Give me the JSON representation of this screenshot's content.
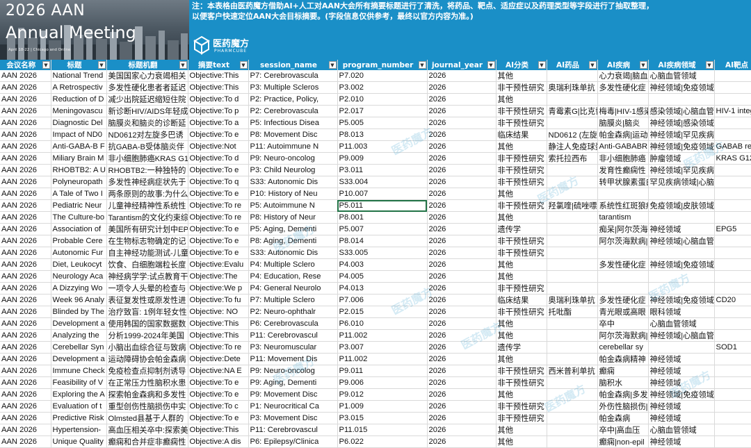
{
  "banner": {
    "hero_title_line1": "2026 AAN",
    "hero_title_line2": "Annual Meeting",
    "hero_sub": "April 18-22 | Chicago and Online",
    "note_line1": "注：本表格由医药魔方借助AI+人工对AAN大会所有摘要标题进行了清洗，将药品、靶点、适应症以及药理类型等字段进行了抽取整理，",
    "note_line2": "以便客户快速定位AAN大会目标摘要。(字段信息仅供参考，最终以官方内容为准。)",
    "logo_name": "医药魔方",
    "logo_sub": "PHARMCUBE",
    "brand_color": "#1a8fc7"
  },
  "table": {
    "columns": [
      "会议名称",
      "标题",
      "标题机翻",
      "摘要text",
      "session_name",
      "program_number",
      "journal_year",
      "AI分类",
      "AI药品",
      "AI疾病",
      "AI疾病领域",
      "AI靶点"
    ],
    "rows": [
      [
        "AAN 2026",
        "National Trend",
        "美国国家心力衰竭相关",
        "Objective:This",
        "P7: Cerebrovascula",
        "P7.020",
        "2026",
        "其他",
        "",
        "心力衰竭|脑血",
        "心脑血管领域",
        ""
      ],
      [
        "AAN 2026",
        "A Retrospectiv",
        "多发性硬化患者者延迟",
        "Objective:This",
        "P3: Multiple Scleros",
        "P3.002",
        "2026",
        "非干预性研究",
        "奥瑞利珠单抗",
        "多发性硬化症",
        "神经领域|免疫领域",
        ""
      ],
      [
        "AAN 2026",
        "Reduction of D",
        "减少出院延迟缩短住院",
        "Objective:To d",
        "P2: Practice, Policy,",
        "P2.010",
        "2026",
        "其他",
        "",
        "",
        "",
        ""
      ],
      [
        "AAN 2026",
        "Meningovascu",
        "新诊断HIV/AIDS年轻成",
        "Objective:To p",
        "P2: Cerebrovascula",
        "P2.017",
        "2026",
        "非干预性研究",
        "青霉素G|比克替",
        "梅毒|HIV-1感染",
        "感染领域|心脑血管",
        "HIV-1 integrase"
      ],
      [
        "AAN 2026",
        "Diagnostic Del",
        "脑膜炎和脑炎的诊断延",
        "Objective:To a",
        "P5: Infectious Disea",
        "P5.005",
        "2026",
        "非干预性研究",
        "",
        "脑膜炎|脑炎",
        "神经领域|感染领域",
        ""
      ],
      [
        "AAN 2026",
        "Impact of ND0",
        "ND0612对左旋多巴诱",
        "Objective:To e",
        "P8: Movement Disc",
        "P8.013",
        "2026",
        "临床结果",
        "ND0612 (左旋",
        "帕金森病|运动",
        "神经领域|罕见疾病",
        ""
      ],
      [
        "AAN 2026",
        "Anti-GABA-B F",
        "抗GABA-B受体脑炎伴",
        "Objective:Not",
        "P11: Autoimmune N",
        "P11.003",
        "2026",
        "其他",
        "静注人免疫球蛋",
        "Anti-GABABR",
        "神经领域|免疫领域",
        "GABAB receptor"
      ],
      [
        "AAN 2026",
        "Miliary Brain M",
        "非小细胞肺癌KRAS G1",
        "Objective:To d",
        "P9: Neuro-oncolog",
        "P9.009",
        "2026",
        "非干预性研究",
        "索托拉西布",
        "非小细胞肺癌",
        "肿瘤领域",
        "KRAS G12C"
      ],
      [
        "AAN 2026",
        "RHOBTB2: A U",
        "RHOBTB2:一种独特的",
        "Objective:To e",
        "P3: Child Neurolog",
        "P3.011",
        "2026",
        "非干预性研究",
        "",
        "发育性癫痫性",
        "神经领域|罕见疾病",
        ""
      ],
      [
        "AAN 2026",
        "Polyneuropath",
        "多发性神经病症状先于",
        "Objective:To q",
        "S33: Autonomic Dis",
        "S33.004",
        "2026",
        "非干预性研究",
        "",
        "转甲状腺素蛋白",
        "罕见疾病领域|心脑",
        ""
      ],
      [
        "AAN 2026",
        "A Tale of Two I",
        "两条原则的故事:为什么",
        "Objective:To e",
        "P10: History of Neu",
        "P10.007",
        "2026",
        "其他",
        "",
        "",
        "",
        ""
      ],
      [
        "AAN 2026",
        "Pediatric Neur",
        "儿童神经精神性系统性",
        "Objective:To re",
        "P5: Autoimmune N",
        "P5.011",
        "2026",
        "非干预性研究",
        "羟氯喹|硫唑嘌",
        "系统性红斑狼疮",
        "免疫领域|皮肤领域",
        ""
      ],
      [
        "AAN 2026",
        "The Culture-bo",
        "Tarantism的文化约束综",
        "Objective:To re",
        "P8: History of Neur",
        "P8.001",
        "2026",
        "其他",
        "",
        "tarantism",
        "",
        ""
      ],
      [
        "AAN 2026",
        "Association of",
        "美国所有研究计划中EP",
        "Objective:To e",
        "P5: Aging, Dementi",
        "P5.007",
        "2026",
        "遗传学",
        "",
        "痴呆|阿尔茨海",
        "神经领域",
        "EPG5"
      ],
      [
        "AAN 2026",
        "Probable Cere",
        "在生物标志物确定的记",
        "Objective:To e",
        "P8: Aging, Dementi",
        "P8.014",
        "2026",
        "非干预性研究",
        "",
        "阿尔茨海默病|",
        "神经领域|心脑血管",
        ""
      ],
      [
        "AAN 2026",
        "Autonomic Fur",
        "自主神经功能测试-儿童",
        "Objective:To e",
        "S33: Autonomic Dis",
        "S33.005",
        "2026",
        "非干预性研究",
        "",
        "",
        "",
        ""
      ],
      [
        "AAN 2026",
        "Diet, Leukocyt",
        "饮食、白细胞端粒长度",
        "Objective:Evalu",
        "P4: Multiple Sclero",
        "P4.003",
        "2026",
        "其他",
        "",
        "多发性硬化症",
        "神经领域|免疫领域",
        ""
      ],
      [
        "AAN 2026",
        "Neurology Aca",
        "神经病学学:试点教育干",
        "Objective:The",
        "P4: Education, Rese",
        "P4.005",
        "2026",
        "其他",
        "",
        "",
        "",
        ""
      ],
      [
        "AAN 2026",
        "A Dizzying Wo",
        "一项令人头晕的检查与",
        "Objective:We p",
        "P4: General Neurolo",
        "P4.013",
        "2026",
        "非干预性研究",
        "",
        "",
        "",
        ""
      ],
      [
        "AAN 2026",
        "Week 96 Analy",
        "表征复发性或原发性进",
        "Objective:To fu",
        "P7: Multiple Sclero",
        "P7.006",
        "2026",
        "临床结果",
        "奥瑞利珠单抗",
        "多发性硬化症",
        "神经领域|免疫领域",
        "CD20"
      ],
      [
        "AAN 2026",
        "Blinded by The",
        "治疗致盲: 1例年轻女性",
        "Objective: NO",
        "P2: Neuro-ophthalr",
        "P2.015",
        "2026",
        "非干预性研究",
        "托吡酯",
        "青光眼或高眼",
        "眼科领域",
        ""
      ],
      [
        "AAN 2026",
        "Development a",
        "使用韩国的国家数据数",
        "Objective:This",
        "P6: Cerebrovascula",
        "P6.010",
        "2026",
        "其他",
        "",
        "卒中",
        "心脑血管领域",
        ""
      ],
      [
        "AAN 2026",
        "Analyzing the",
        "分析1999-2024年美国",
        "Objective:This",
        "P11: Cerebrovascul",
        "P11.002",
        "2026",
        "其他",
        "",
        "阿尔茨海默病|",
        "神经领域|心脑血管",
        ""
      ],
      [
        "AAN 2026",
        "Cerebellar Syn",
        "小脑出血综合征与致病",
        "Objective:To re",
        "P3: Neuromuscular",
        "P3.007",
        "2026",
        "遗传学",
        "",
        "cerebellar sy",
        "",
        "SOD1"
      ],
      [
        "AAN 2026",
        "Development a",
        "运动障碍协会帕金森病",
        "Objective:Dete",
        "P11: Movement Dis",
        "P11.002",
        "2026",
        "其他",
        "",
        "帕金森病精神",
        "神经领域",
        ""
      ],
      [
        "AAN 2026",
        "Immune Check",
        "免疫检查点抑制剂诱导",
        "Objective:NA E",
        "P9: Neuro-oncolog",
        "P9.011",
        "2026",
        "非干预性研究",
        "西米普利单抗",
        "癫痫",
        "神经领域",
        ""
      ],
      [
        "AAN 2026",
        "Feasibility of V",
        "在正常压力性脑积水患",
        "Objective:To e",
        "P9: Aging, Dementi",
        "P9.006",
        "2026",
        "非干预性研究",
        "",
        "脑积水",
        "神经领域",
        ""
      ],
      [
        "AAN 2026",
        "Exploring the A",
        "探索帕金森病和多发性",
        "Objective:To e",
        "P9: Movement Disc",
        "P9.012",
        "2026",
        "其他",
        "",
        "帕金森病|多发",
        "神经领域|免疫领域",
        ""
      ],
      [
        "AAN 2026",
        "Evaluation of t",
        "重型创伤性脑损伤中实",
        "Objective:To c",
        "P1: Neurocritical Ca",
        "P1.009",
        "2026",
        "非干预性研究",
        "",
        "外伤性脑损伤|",
        "神经领域",
        ""
      ],
      [
        "AAN 2026",
        "Predictive Risk",
        "Olmsted县基于人群的",
        "Objective:To e",
        "P3: Movement Disc",
        "P3.015",
        "2026",
        "非干预性研究",
        "",
        "帕金森病",
        "神经领域",
        ""
      ],
      [
        "AAN 2026",
        "Hypertension-",
        "高血压相关卒中:探索美",
        "Objective:This",
        "P11: Cerebrovascul",
        "P11.015",
        "2026",
        "其他",
        "",
        "卒中|高血压",
        "心脑血管领域",
        ""
      ],
      [
        "AAN 2026",
        "Unique Quality",
        "癫痫和合并症非癫痫性",
        "Objective:A dis",
        "P6: Epilepsy/Clinica",
        "P6.022",
        "2026",
        "其他",
        "",
        "癫痫|non-epil",
        "神经领域",
        ""
      ]
    ],
    "selected_row": 11,
    "selected_col": 5
  },
  "watermark_text": "医药魔方"
}
